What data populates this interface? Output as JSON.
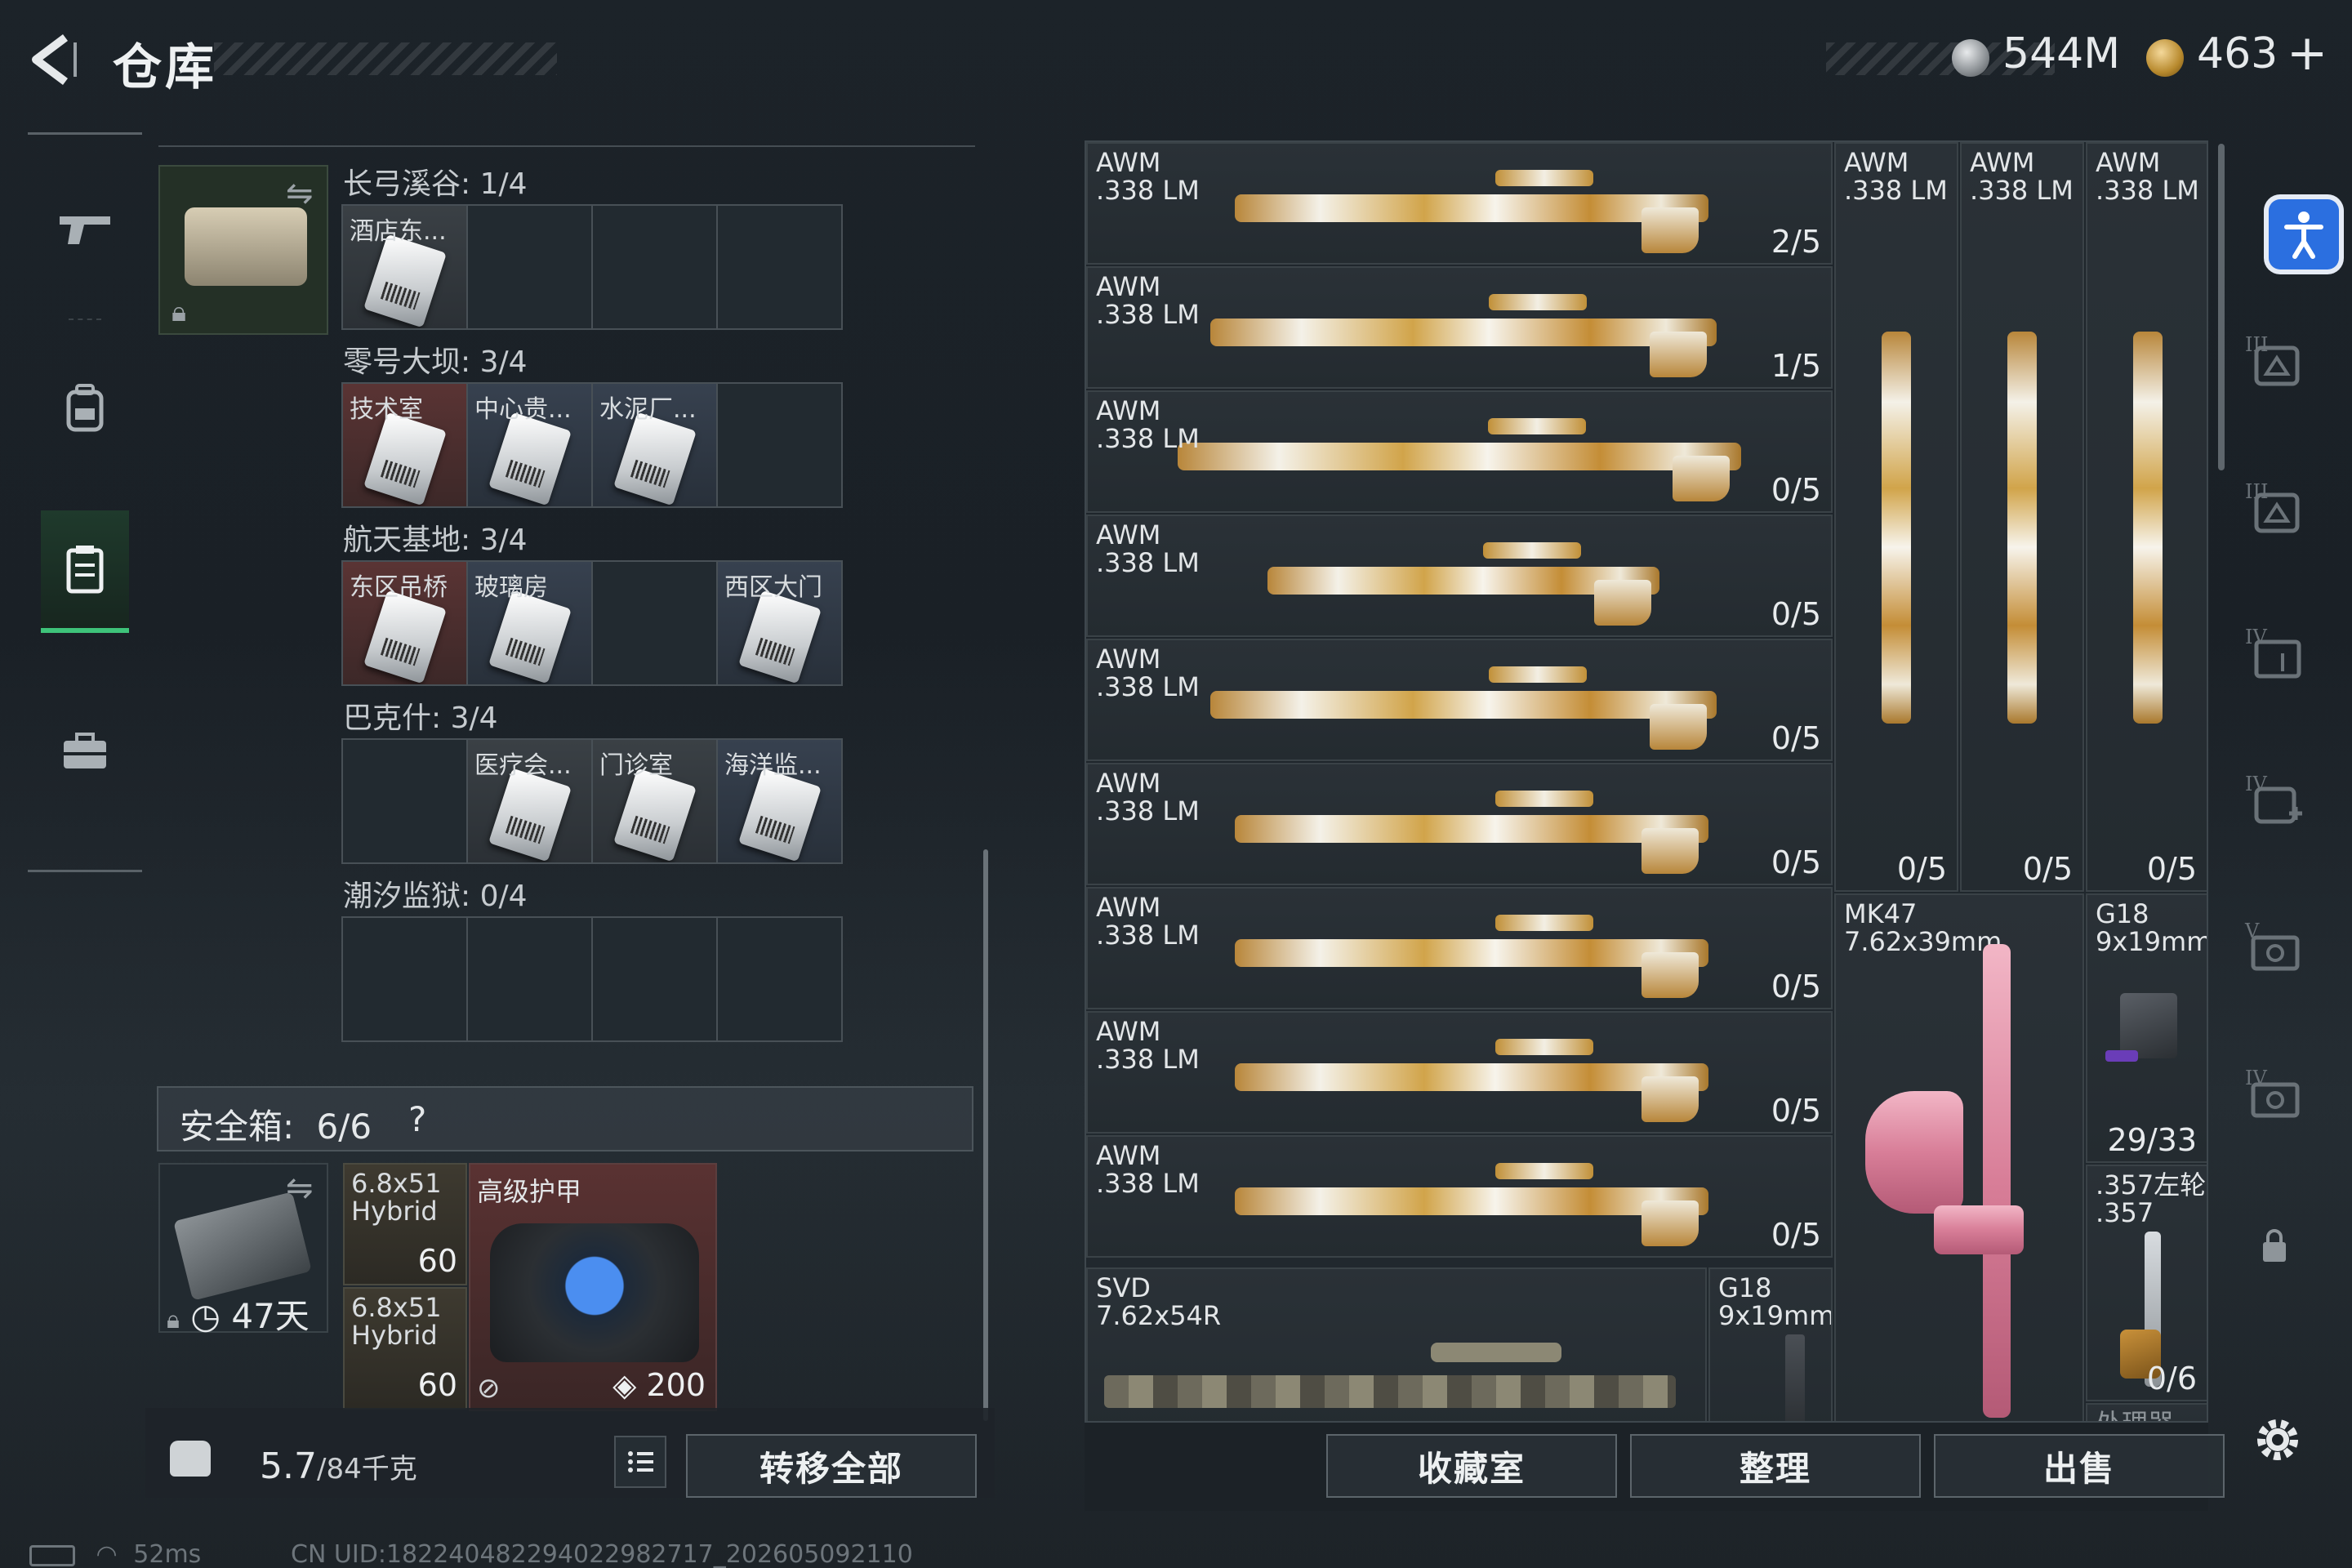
{
  "header": {
    "title": "仓库",
    "currency1": "544M",
    "currency2": "463",
    "add_label": "+"
  },
  "nav": {
    "items": [
      "weapons",
      "backpack",
      "stash",
      "briefcase"
    ],
    "active": 2
  },
  "keycards": {
    "regions": [
      {
        "label": "长弓溪谷: 1/4",
        "cells": [
          {
            "name": "酒店东...",
            "color": "grey",
            "card": true
          },
          {
            "name": "",
            "card": false
          },
          {
            "name": "",
            "card": false
          },
          {
            "name": "",
            "card": false
          }
        ]
      },
      {
        "label": "零号大坝: 3/4",
        "cells": [
          {
            "name": "技术室",
            "color": "red",
            "card": true
          },
          {
            "name": "中心贵...",
            "color": "blue",
            "card": true
          },
          {
            "name": "水泥厂...",
            "color": "blue",
            "card": true
          },
          {
            "name": "",
            "card": false
          }
        ]
      },
      {
        "label": "航天基地: 3/4",
        "cells": [
          {
            "name": "东区吊桥",
            "color": "red",
            "card": true
          },
          {
            "name": "玻璃房",
            "color": "blue",
            "card": true
          },
          {
            "name": "",
            "card": false
          },
          {
            "name": "西区大门",
            "color": "blue",
            "card": true
          }
        ]
      },
      {
        "label": "巴克什: 3/4",
        "cells": [
          {
            "name": "",
            "card": false
          },
          {
            "name": "医疗会...",
            "color": "grey",
            "card": true
          },
          {
            "name": "门诊室",
            "color": "grey",
            "card": true
          },
          {
            "name": "海洋监...",
            "color": "blue",
            "card": true
          }
        ]
      },
      {
        "label": "潮汐监狱: 0/4",
        "cells": [
          {
            "name": "",
            "card": false
          },
          {
            "name": "",
            "card": false
          },
          {
            "name": "",
            "card": false
          },
          {
            "name": "",
            "card": false
          }
        ]
      }
    ]
  },
  "safe_box": {
    "label": "安全箱:",
    "count": "6/6",
    "help": "?",
    "timer": "47天",
    "ammo": [
      {
        "name": "6.8x51\nHybrid",
        "count": "60"
      },
      {
        "name": "6.8x51\nHybrid",
        "count": "60"
      }
    ],
    "armor": {
      "name": "高级护甲",
      "durability": "200"
    }
  },
  "footer_left": {
    "weight": "5.7",
    "capacity": "/84千克",
    "transfer_label": "转移全部"
  },
  "weapons": [
    {
      "name": "AWM\n.338 LM",
      "count": "2/5"
    },
    {
      "name": "AWM\n.338 LM",
      "count": "1/5"
    },
    {
      "name": "AWM\n.338 LM",
      "count": "0/5"
    },
    {
      "name": "AWM\n.338 LM",
      "count": "0/5"
    },
    {
      "name": "AWM\n.338 LM",
      "count": "0/5"
    },
    {
      "name": "AWM\n.338 LM",
      "count": "0/5"
    },
    {
      "name": "AWM\n.338 LM",
      "count": "0/5"
    },
    {
      "name": "AWM\n.338 LM",
      "count": "0/5"
    },
    {
      "name": "AWM\n.338 LM",
      "count": "0/5"
    }
  ],
  "vertical_weapons": [
    {
      "name": "AWM\n.338 LM",
      "count": "0/5"
    },
    {
      "name": "AWM\n.338 LM",
      "count": "0/5"
    },
    {
      "name": "AWM\n.338 LM",
      "count": "0/5"
    }
  ],
  "misc_weapons": {
    "svd": {
      "name": "SVD\n7.62x54R"
    },
    "g18_small": {
      "name": "G18\n9x19mm"
    },
    "mk47": {
      "name": "MK47\n7.62x39mm"
    },
    "g18": {
      "name": "G18\n9x19mm",
      "count": "29/33"
    },
    "revolver": {
      "name": ".357左轮\n.357",
      "count": "0/6"
    },
    "partial": {
      "name": "处理器"
    }
  },
  "footer_right": {
    "fav_label": "收藏室",
    "sort_label": "整理",
    "sell_label": "出售"
  },
  "status": {
    "ping": "52ms",
    "uid": "CN UID:182240482294022982717_202605092110"
  },
  "colors": {
    "accent": "#3ec37a",
    "armor_bg": "#5a3232",
    "keycard_red": "#5a3434"
  }
}
